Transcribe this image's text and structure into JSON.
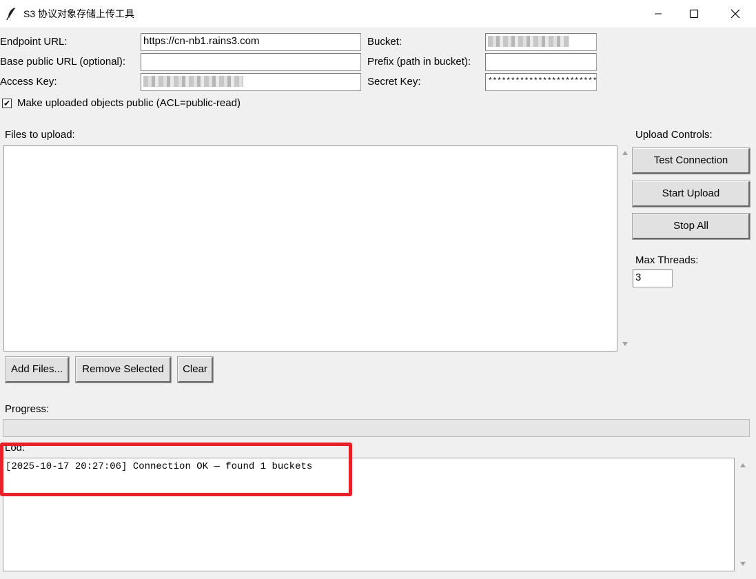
{
  "window": {
    "title": "S3 协议对象存储上传工具",
    "icon": "feather-icon"
  },
  "form": {
    "endpoint_label": "Endpoint URL:",
    "endpoint_value": "https://cn-nb1.rains3.com",
    "base_url_label": "Base public URL (optional):",
    "base_url_value": "",
    "access_key_label": "Access Key:",
    "bucket_label": "Bucket:",
    "prefix_label": "Prefix (path in bucket):",
    "prefix_value": "",
    "secret_key_label": "Secret Key:",
    "secret_key_value": "*************************",
    "public_checkbox_label": "Make uploaded objects public (ACL=public-read)",
    "public_checkbox_checked": true
  },
  "files": {
    "label": "Files to upload:",
    "items": [],
    "add_button": "Add Files...",
    "remove_button": "Remove Selected",
    "clear_button": "Clear"
  },
  "controls": {
    "label": "Upload Controls:",
    "test_button": "Test Connection",
    "start_button": "Start Upload",
    "stop_button": "Stop All",
    "max_threads_label": "Max Threads:",
    "max_threads_value": "3"
  },
  "progress": {
    "label": "Progress:",
    "fraction": 0
  },
  "log": {
    "label": "Log:",
    "lines": [
      "[2025-10-17 20:27:06] Connection OK — found 1 buckets"
    ]
  },
  "colors": {
    "highlight": "#e8202a",
    "button_face": "#e1e1e1",
    "window_bg": "#f0f0f0"
  }
}
